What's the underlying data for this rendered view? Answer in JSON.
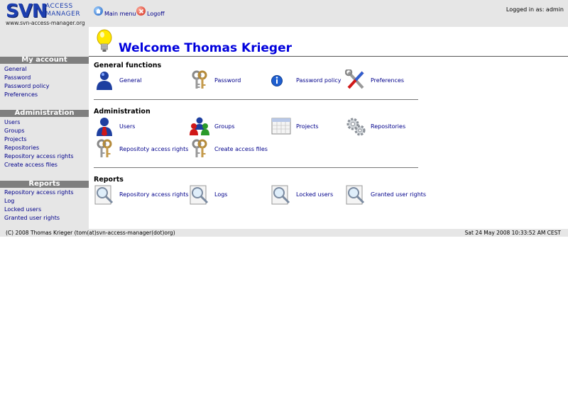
{
  "header": {
    "logo_main": "SVN",
    "logo_line1": "ACCESS",
    "logo_line2": "MANAGER",
    "logo_url": "www.svn-access-manager.org",
    "main_menu": "Main menu",
    "logoff": "Logoff",
    "logged_in": "Logged in as: admin"
  },
  "sidebar": {
    "my_account": {
      "title": "My account",
      "items": [
        "General",
        "Password",
        "Password policy",
        "Preferences"
      ]
    },
    "administration": {
      "title": "Administration",
      "items": [
        "Users",
        "Groups",
        "Projects",
        "Repositories",
        "Repository access rights",
        "Create access files"
      ]
    },
    "reports": {
      "title": "Reports",
      "items": [
        "Repository access rights",
        "Log",
        "Locked users",
        "Granted user rights"
      ]
    }
  },
  "main": {
    "welcome": "Welcome Thomas Krieger",
    "general_functions": {
      "title": "General functions",
      "items": [
        {
          "label": "General",
          "icon": "user-icon"
        },
        {
          "label": "Password",
          "icon": "keys-icon"
        },
        {
          "label": "Password policy",
          "icon": "info-icon"
        },
        {
          "label": "Preferences",
          "icon": "tools-icon"
        }
      ]
    },
    "administration": {
      "title": "Administration",
      "items": [
        {
          "label": "Users",
          "icon": "user-icon"
        },
        {
          "label": "Groups",
          "icon": "group-icon"
        },
        {
          "label": "Projects",
          "icon": "calendar-icon"
        },
        {
          "label": "Repositories",
          "icon": "gears-icon"
        },
        {
          "label": "Repositoty access rights",
          "icon": "keys-icon"
        },
        {
          "label": "Create access files",
          "icon": "keys-icon"
        }
      ]
    },
    "reports": {
      "title": "Reports",
      "items": [
        {
          "label": "Repository access rights",
          "icon": "magnifier-icon"
        },
        {
          "label": "Logs",
          "icon": "magnifier-icon"
        },
        {
          "label": "Locked users",
          "icon": "magnifier-icon"
        },
        {
          "label": "Granted user rights",
          "icon": "magnifier-icon"
        }
      ]
    }
  },
  "footer": {
    "copyright": "(C) 2008 Thomas Krieger (tom(at)svn-access-manager(dot)org)",
    "datetime": "Sat 24 May 2008 10:33:52 AM CEST"
  }
}
